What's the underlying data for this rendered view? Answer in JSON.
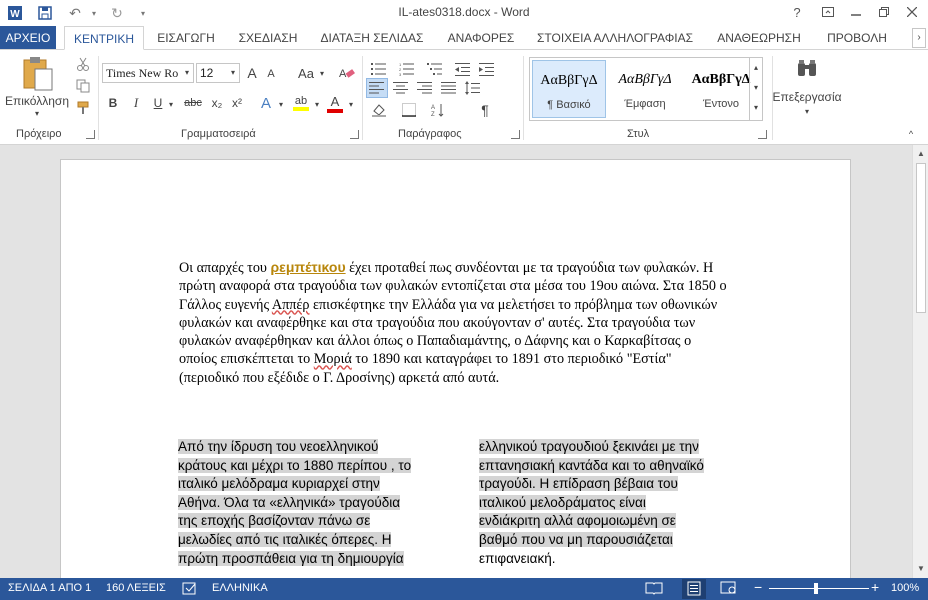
{
  "window": {
    "title": "IL-ates0318.docx - Word",
    "help": "?",
    "controls": [
      "minimize",
      "maximize",
      "close"
    ]
  },
  "quick_access": {
    "undo_glyph": "↶",
    "redo_glyph": "↻"
  },
  "tabs": [
    {
      "label": "ΑΡΧΕΙΟ"
    },
    {
      "label": "ΚΕΝΤΡΙΚΗ"
    },
    {
      "label": "ΕΙΣΑΓΩΓΗ"
    },
    {
      "label": "ΣΧΕΔΙΑΣΗ"
    },
    {
      "label": "ΔΙΑΤΑΞΗ ΣΕΛΙΔΑΣ"
    },
    {
      "label": "ΑΝΑΦΟΡΕΣ"
    },
    {
      "label": "ΣΤΟΙΧΕΙΑ ΑΛΛΗΛΟΓΡΑΦΙΑΣ"
    },
    {
      "label": "ΑΝΑΘΕΩΡΗΣΗ"
    },
    {
      "label": "ΠΡΟΒΟΛΗ"
    }
  ],
  "ribbon": {
    "clipboard": {
      "paste_label": "Επικόλληση",
      "group_label": "Πρόχειρο"
    },
    "font": {
      "font_name": "Times New Ro",
      "font_size": "12",
      "grow": "A",
      "shrink": "A",
      "case": "Aa",
      "bold": "B",
      "italic": "I",
      "underline": "U",
      "strike": "abc",
      "subscript": "x₂",
      "superscript": "x²",
      "effects": "A",
      "highlight": "ab",
      "color": "A",
      "group_label": "Γραμματοσειρά"
    },
    "paragraph": {
      "pilcrow": "¶",
      "group_label": "Παράγραφος"
    },
    "styles": {
      "items": [
        {
          "sample": "ΑαΒβΓγΔ",
          "name": "¶ Βασικό"
        },
        {
          "sample": "ΑαΒβΓγΔ",
          "name": "Έμφαση"
        },
        {
          "sample": "ΑαΒβΓγΔ",
          "name": "Έντονο"
        }
      ],
      "group_label": "Στυλ"
    },
    "editing": {
      "label": "Επεξεργασία"
    },
    "accent_color": "#2b579a"
  },
  "document": {
    "paragraph": {
      "before_link": "Οι απαρχές του ",
      "link_word": "ρεμπέτικου",
      "after_link": " έχει προταθεί πως συνδέονται με τα τραγούδια των φυλακών. Η πρώτη αναφορά στα τραγούδια των φυλακών εντοπίζεται στα μέσα του 19ου αιώνα. Στα 1850 ο Γάλλος ευγενής ",
      "squig1": "Αππέρ",
      "mid": " επισκέφτηκε την Ελλάδα για να μελετήσει το πρόβλημα των οθωνικών φυλακών και αναφέρθηκε και στα τραγούδια που ακούγονταν σ' αυτές. Στα τραγούδια των φυλακών αναφέρθηκαν και άλλοι όπως ο Παπαδιαμάντης, ο Δάφνης και ο Καρκαβίτσας ο οποίος επισκέπτεται  το ",
      "squig2": "Μοριά",
      "end": " το 1890 και καταγράφει το 1891 στο περιοδικό  \"Εστία\" (περιοδικό που εξέδιδε ο Γ. Δροσίνης) αρκετά από αυτά."
    },
    "left_column": [
      "Από την ίδρυση του νεοελληνικού",
      "κράτους και μέχρι το 1880 περίπου , το",
      "ιταλικό μελόδραμα κυριαρχεί στην",
      "Αθήνα.  Όλα τα «ελληνικά» τραγούδια",
      "της εποχής βασίζονταν πάνω σε",
      "μελωδίες από τις ιταλικές όπερες. Η",
      "πρώτη προσπάθεια για τη δημιουργία"
    ],
    "right_column": [
      "ελληνικού τραγουδιού ξεκινάει με την",
      "επτανησιακή καντάδα και το αθηναϊκό",
      "τραγούδι. Η επίδραση βέβαια του",
      "ιταλικού μελοδράματος είναι",
      "ενδιάκριτη αλλά αφομοιωμένη σε",
      "βαθμό που να μη παρουσιάζεται",
      "επιφανειακή."
    ],
    "right_column_shaded_lines": 6,
    "highlight_color": "#d4d4d4"
  },
  "status": {
    "page": "ΣΕΛΙΔΑ 1 ΑΠΟ 1",
    "words": "160 ΛΕΞΕΙΣ",
    "language": "ΕΛΛΗΝΙΚΑ",
    "zoom_minus": "−",
    "zoom_plus": "+",
    "zoom": "100%"
  }
}
